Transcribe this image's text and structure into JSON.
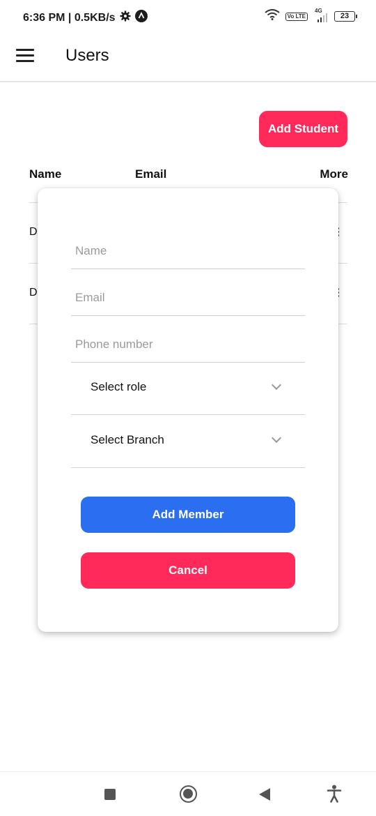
{
  "status_bar": {
    "time_speed": "6:36 PM | 0.5KB/s",
    "network_label": "4G",
    "volte_label": "Vo LTE",
    "battery": "23"
  },
  "app_bar": {
    "title": "Users"
  },
  "actions": {
    "add_student_label": "Add Student"
  },
  "colors": {
    "primary_pink": "#ff2a5a",
    "primary_blue": "#2b6ef0"
  },
  "table": {
    "headers": {
      "name": "Name",
      "email": "Email",
      "more": "More"
    },
    "rows": [
      {
        "name_initial": "D"
      },
      {
        "name_initial": "D"
      }
    ]
  },
  "modal": {
    "name_placeholder": "Name",
    "email_placeholder": "Email",
    "phone_placeholder": "Phone number",
    "role_select": "Select role",
    "branch_select": "Select Branch",
    "add_member_label": "Add Member",
    "cancel_label": "Cancel"
  },
  "icons": {
    "menu": "menu-icon",
    "settings": "gear-icon",
    "notification": "app-notification-icon",
    "wifi": "wifi-icon",
    "signal": "signal-icon",
    "battery": "battery-icon",
    "chevron": "chevron-down-icon",
    "recents": "square-icon",
    "home": "home-circle-icon",
    "back": "back-triangle-icon",
    "accessibility": "accessibility-icon"
  }
}
